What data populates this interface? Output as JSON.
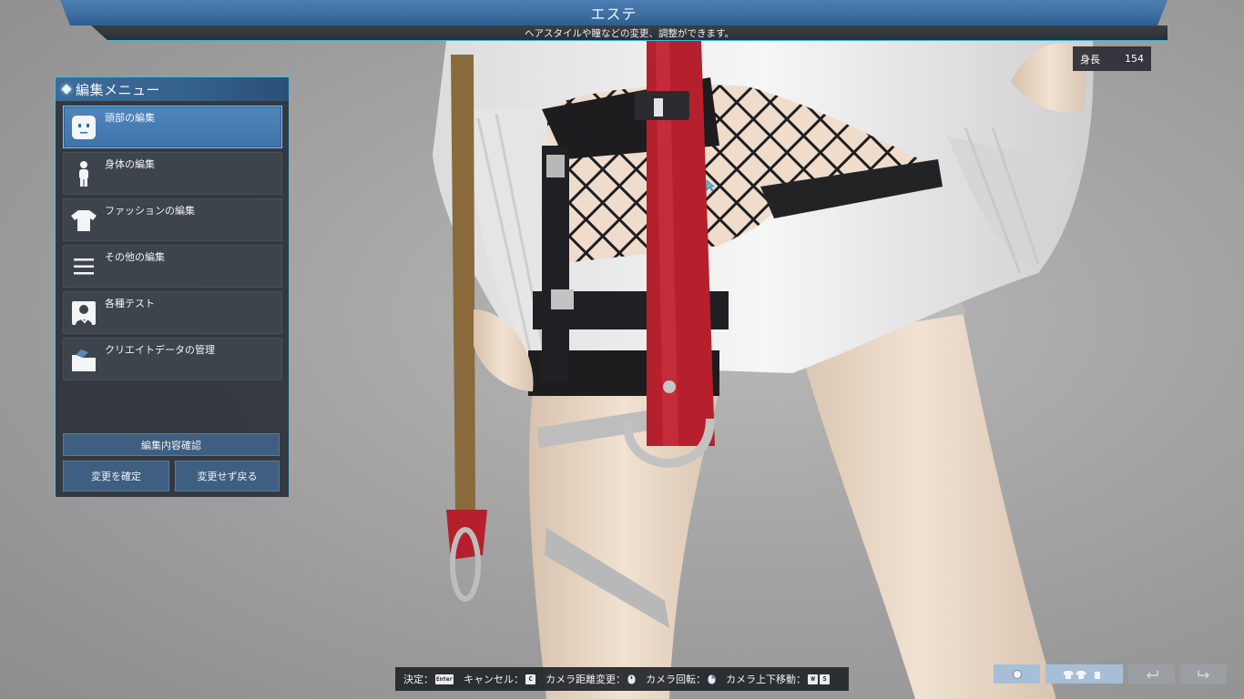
{
  "banner": {
    "title": "エステ",
    "subtitle": "ヘアスタイルや瞳などの変更、調整ができます。"
  },
  "height": {
    "label": "身長",
    "value": "154"
  },
  "menu": {
    "title": "編集メニュー",
    "items": [
      {
        "label": "頭部の編集",
        "icon": "face-icon",
        "selected": true
      },
      {
        "label": "身体の編集",
        "icon": "body-icon",
        "selected": false
      },
      {
        "label": "ファッションの編集",
        "icon": "shirt-icon",
        "selected": false
      },
      {
        "label": "その他の編集",
        "icon": "list-icon",
        "selected": false
      },
      {
        "label": "各種テスト",
        "icon": "test-person-icon",
        "selected": false
      },
      {
        "label": "クリエイトデータの管理",
        "icon": "folder-icon",
        "selected": false
      }
    ],
    "review_label": "編集内容確認",
    "confirm_label": "変更を確定",
    "revert_label": "変更せず戻る"
  },
  "guide": {
    "confirm": "決定：",
    "confirm_key": "Enter",
    "cancel": "キャンセル：",
    "cancel_key": "C",
    "zoom": "カメラ距離変更：",
    "rotate": "カメラ回転：",
    "vertical": "カメラ上下移動：",
    "vertical_key_1": "W",
    "vertical_key_2": "S"
  },
  "colors": {
    "accent_cyan": "#39c4e0",
    "banner_blue": "#4c7eb1",
    "selected_blue": "#4f86bb",
    "panel_dark": "#2c323a"
  }
}
